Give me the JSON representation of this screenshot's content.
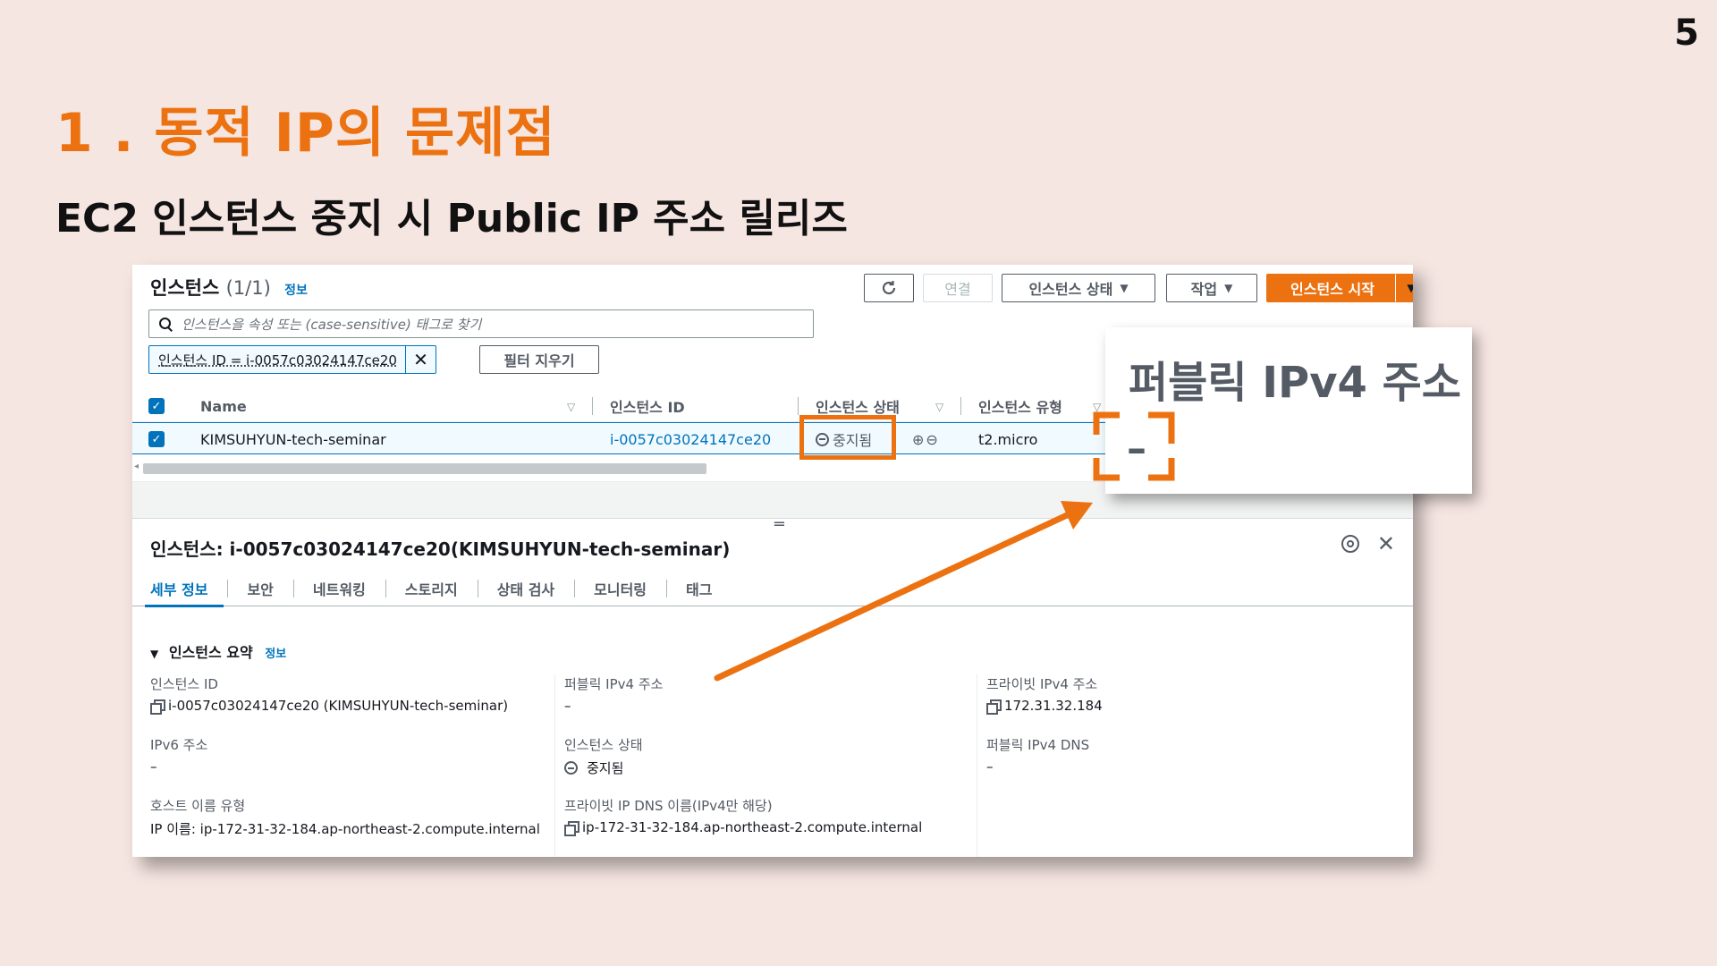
{
  "slide": {
    "number": "5",
    "title": "1 . 동적 IP의 문제점",
    "subtitle": "EC2 인스턴스 중지 시 Public IP 주소 릴리즈"
  },
  "console": {
    "instances_label": "인스턴스",
    "instances_count": "(1/1)",
    "info_link": "정보",
    "buttons": {
      "refresh_icon": "refresh-icon",
      "connect": "연결",
      "instance_state": "인스턴스 상태",
      "actions": "작업",
      "launch": "인스턴스 시작"
    },
    "search_placeholder": "인스턴스을 속성 또는 (case-sensitive) 태그로 찾기",
    "filter_token": "인스턴스 ID = i-0057c03024147ce20",
    "clear_filters": "필터 지우기",
    "table": {
      "headers": [
        "Name",
        "인스턴스 ID",
        "인스턴스 상태",
        "인스턴스 유형"
      ],
      "row": {
        "name": "KIMSUHYUN-tech-seminar",
        "instance_id": "i-0057c03024147ce20",
        "state": "중지됨",
        "type": "t2.micro"
      }
    }
  },
  "detail": {
    "title": "인스턴스: i-0057c03024147ce20(KIMSUHYUN-tech-seminar)",
    "tabs": [
      "세부 정보",
      "보안",
      "네트워킹",
      "스토리지",
      "상태 검사",
      "모니터링",
      "태그"
    ],
    "section_title": "인스턴스 요약",
    "section_info": "정보",
    "fields": {
      "instance_id_label": "인스턴스 ID",
      "instance_id_value": "i-0057c03024147ce20 (KIMSUHYUN-tech-seminar)",
      "ipv6_label": "IPv6 주소",
      "ipv6_value": "–",
      "hostname_type_label": "호스트 이름 유형",
      "hostname_type_value": "IP 이름: ip-172-31-32-184.ap-northeast-2.compute.internal",
      "public_ipv4_label": "퍼블릭 IPv4 주소",
      "public_ipv4_value": "–",
      "state_label": "인스턴스 상태",
      "state_value": "중지됨",
      "private_dns_label": "프라이빗 IP DNS 이름(IPv4만 해당)",
      "private_dns_value": "ip-172-31-32-184.ap-northeast-2.compute.internal",
      "private_ipv4_label": "프라이빗 IPv4 주소",
      "private_ipv4_value": "172.31.32.184",
      "public_dns_label": "퍼블릭 IPv4 DNS",
      "public_dns_value": "–"
    }
  },
  "callout": {
    "title": "퍼블릭 IPv4 주소",
    "value": "–"
  },
  "colors": {
    "accent": "#ec7211",
    "link": "#0073bb",
    "background": "#f6e6e2"
  }
}
